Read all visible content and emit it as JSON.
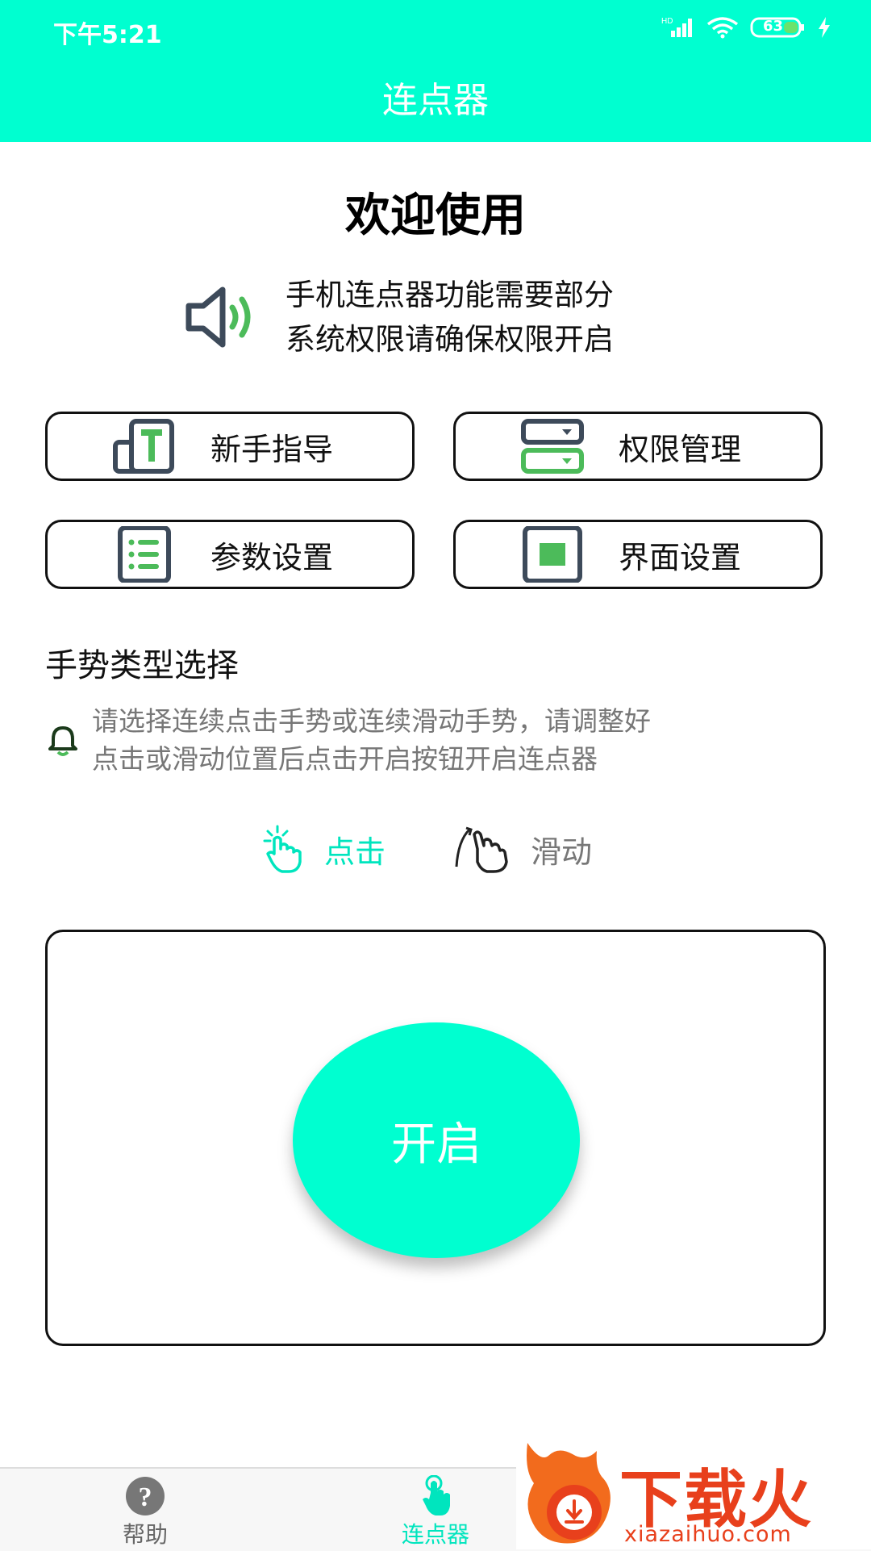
{
  "status_bar": {
    "time": "下午5:21",
    "signal_label": "HD",
    "battery": "63"
  },
  "header": {
    "title": "连点器"
  },
  "welcome": {
    "title": "欢迎使用",
    "notice_line1": "手机连点器功能需要部分",
    "notice_line2": "系统权限请确保权限开启"
  },
  "features": [
    {
      "label": "新手指导",
      "icon": "guide-icon"
    },
    {
      "label": "权限管理",
      "icon": "permission-icon"
    },
    {
      "label": "参数设置",
      "icon": "params-icon"
    },
    {
      "label": "界面设置",
      "icon": "interface-icon"
    }
  ],
  "gesture_section": {
    "title": "手势类型选择",
    "hint_line1": "请选择连续点击手势或连续滑动手势，请调整好",
    "hint_line2": "点击或滑动位置后点击开启按钮开启连点器",
    "options": [
      {
        "label": "点击",
        "selected": true
      },
      {
        "label": "滑动",
        "selected": false
      }
    ]
  },
  "start_button": {
    "label": "开启"
  },
  "bottom_nav": [
    {
      "label": "帮助",
      "icon": "help-icon",
      "active": false
    },
    {
      "label": "连点器",
      "icon": "tap-hand-icon",
      "active": true
    }
  ],
  "watermark": {
    "text": "下载火",
    "url": "xiazaihuo.com"
  },
  "colors": {
    "accent": "#00FFD0",
    "accent_text": "#00E5BE",
    "icon_green": "#4CBB5A",
    "logo_red": "#E8401C"
  }
}
